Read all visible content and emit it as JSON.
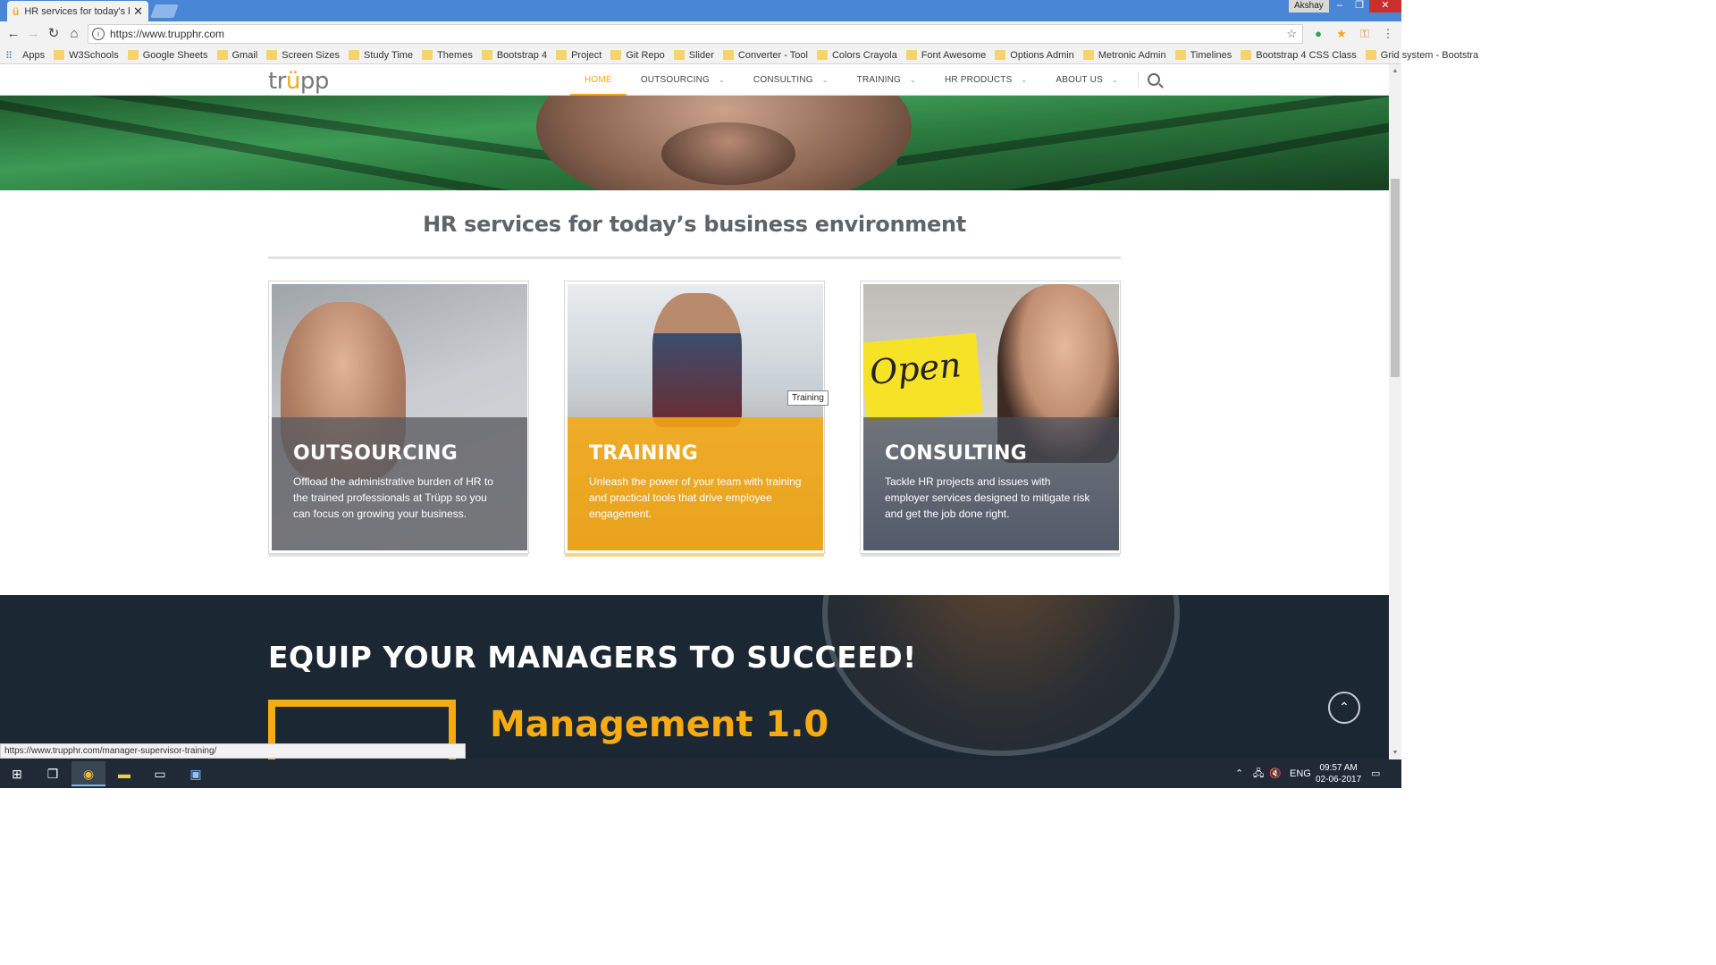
{
  "browser": {
    "tab_title": "HR services for today's b",
    "profile": "Akshay",
    "url": "https://www.trupphr.com",
    "bookmarks": [
      {
        "label": "Apps",
        "icon": "apps-icon"
      },
      {
        "label": "W3Schools",
        "icon": "w3schools-icon"
      },
      {
        "label": "Google Sheets",
        "icon": "sheets-icon"
      },
      {
        "label": "Gmail",
        "icon": "gmail-icon"
      },
      {
        "label": "Screen Sizes",
        "icon": "screensizes-icon"
      },
      {
        "label": "Study Time",
        "icon": "folder-icon"
      },
      {
        "label": "Themes",
        "icon": "folder-icon"
      },
      {
        "label": "Bootstrap 4",
        "icon": "folder-icon"
      },
      {
        "label": "Project",
        "icon": "folder-icon"
      },
      {
        "label": "Git Repo",
        "icon": "folder-icon"
      },
      {
        "label": "Slider",
        "icon": "slider-icon"
      },
      {
        "label": "Converter - Tool",
        "icon": "bt-icon"
      },
      {
        "label": "Colors Crayola",
        "icon": "colors-icon"
      },
      {
        "label": "Font Awesome",
        "icon": "fontawesome-icon"
      },
      {
        "label": "Options Admin",
        "icon": "options-icon"
      },
      {
        "label": "Metronic Admin",
        "icon": "page-icon"
      },
      {
        "label": "Timelines",
        "icon": "timelines-icon"
      },
      {
        "label": "Bootstrap 4 CSS Class",
        "icon": "bootstrap-icon"
      },
      {
        "label": "Grid system - Bootstra",
        "icon": "bootstrap-b-icon"
      }
    ],
    "status_url": "https://www.trupphr.com/manager-supervisor-training/"
  },
  "site": {
    "logo_pre": "tr",
    "logo_accent": "ü",
    "logo_post": "pp",
    "nav": [
      {
        "label": "HOME",
        "active": true
      },
      {
        "label": "OUTSOURCING"
      },
      {
        "label": "CONSULTING"
      },
      {
        "label": "TRAINING"
      },
      {
        "label": "HR PRODUCTS"
      },
      {
        "label": "ABOUT US"
      }
    ],
    "section_title": "HR services for today’s business environment",
    "cards": [
      {
        "title": "OUTSOURCING",
        "desc": "Offload the administrative burden of HR to the trained professionals at Trüpp so you can focus on growing your business."
      },
      {
        "title": "TRAINING",
        "desc": "Unleash the power of your team with training and practical tools that drive employee engagement."
      },
      {
        "title": "CONSULTING",
        "desc": "Tackle HR projects and issues with employer services designed to mitigate risk and get the job done right."
      }
    ],
    "sign_text": "Open",
    "tooltip": "Training",
    "cta_title": "EQUIP YOUR MANAGERS TO SUCCEED!",
    "cta_sub": "Management 1.0"
  },
  "taskbar": {
    "lang": "ENG",
    "time": "09:57 AM",
    "date": "02-06-2017"
  },
  "colors": {
    "accent": "#f0a818",
    "training": "#f6aa14",
    "dark": "#1b2733"
  }
}
